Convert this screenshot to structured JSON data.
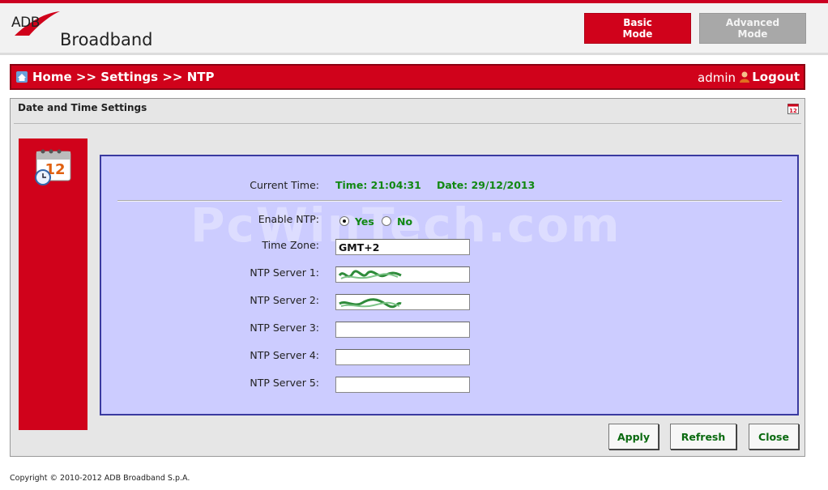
{
  "brand": {
    "logo_top": "ADB",
    "logo_bottom": "Broadband"
  },
  "modes": {
    "basic": [
      "Basic",
      "Mode"
    ],
    "advanced": [
      "Advanced",
      "Mode"
    ]
  },
  "nav": {
    "home": "Home",
    "sep1": ">>",
    "settings": "Settings",
    "sep2": ">>",
    "page": "NTP",
    "user": "admin",
    "logout": "Logout"
  },
  "panel": {
    "title": "Date and Time Settings"
  },
  "form": {
    "current_time_label": "Current Time:",
    "time_value": "Time: 21:04:31",
    "date_value": "Date: 29/12/2013",
    "enable_ntp_label": "Enable NTP:",
    "enable_yes": "Yes",
    "enable_no": "No",
    "enable_selected": "Yes",
    "time_zone_label": "Time Zone:",
    "time_zone_value": "GMT+2",
    "ntp_servers": [
      {
        "label": "NTP Server 1:",
        "value": ""
      },
      {
        "label": "NTP Server 2:",
        "value": ""
      },
      {
        "label": "NTP Server 3:",
        "value": ""
      },
      {
        "label": "NTP Server 4:",
        "value": ""
      },
      {
        "label": "NTP Server 5:",
        "value": ""
      }
    ]
  },
  "watermark": "PcWinTech.com",
  "buttons": {
    "apply": "Apply",
    "refresh": "Refresh",
    "close": "Close"
  },
  "footer": "Copyright © 2010-2012 ADB Broadband S.p.A.",
  "colors": {
    "brand_red": "#d0021b",
    "form_bg": "#ccccff",
    "form_border": "#3a3aa0",
    "value_green": "#118811"
  }
}
